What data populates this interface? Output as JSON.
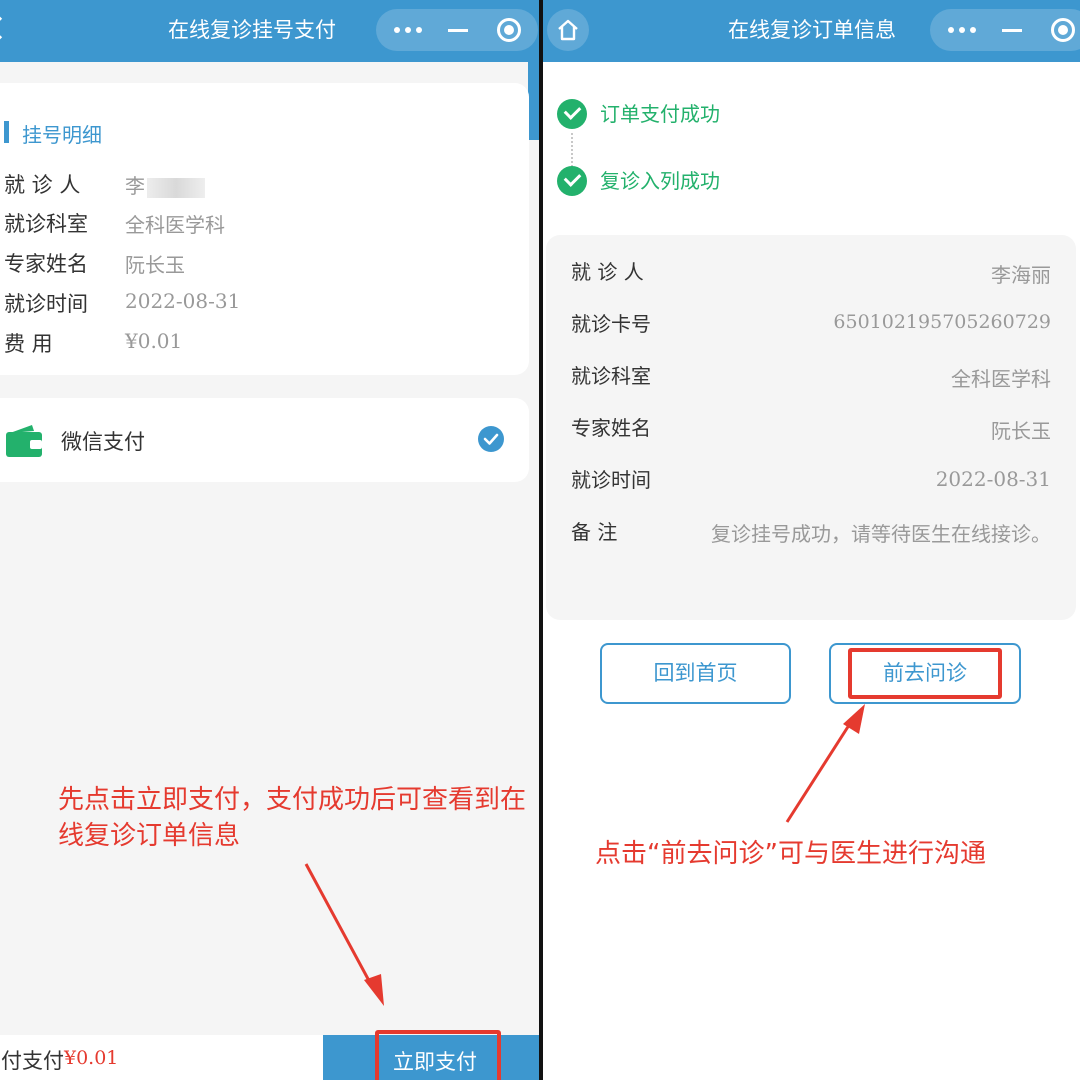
{
  "left": {
    "title": "在线复诊挂号支付",
    "section_title": "挂号明细",
    "rows": [
      {
        "label": "就 诊 人",
        "value": "李"
      },
      {
        "label": "就诊科室",
        "value": "全科医学科"
      },
      {
        "label": "专家姓名",
        "value": "阮长玉"
      },
      {
        "label": "就诊时间",
        "value": "2022-08-31"
      },
      {
        "label": "费 用",
        "value": "¥0.01"
      }
    ],
    "payment_method": "微信支付",
    "footer_label": "实付支付",
    "footer_amount": "¥0.01",
    "pay_button": "立即支付",
    "annotation": "先点击立即支付，支付成功后可查看到在线复诊订单信息"
  },
  "right": {
    "title": "在线复诊订单信息",
    "steps": [
      "订单支付成功",
      "复诊入列成功"
    ],
    "rows": [
      {
        "label": "就 诊 人",
        "value": "李海丽"
      },
      {
        "label": "就诊卡号",
        "value": "650102195705260729"
      },
      {
        "label": "就诊科室",
        "value": "全科医学科"
      },
      {
        "label": "专家姓名",
        "value": "阮长玉"
      },
      {
        "label": "就诊时间",
        "value": "2022-08-31"
      },
      {
        "label": "备 注",
        "value": "复诊挂号成功，请等待医生在线接诊。"
      }
    ],
    "home_button": "回到首页",
    "consult_button": "前去问诊",
    "annotation": "点击“前去问诊”可与医生进行沟通"
  },
  "colors": {
    "brand": "#3d97cf",
    "success": "#23b16c",
    "highlight": "#e53a2f"
  },
  "icons": [
    "chevron-left-icon",
    "more-dots-icon",
    "minimize-icon",
    "close-target-icon",
    "home-icon",
    "wallet-icon",
    "check-circle-icon"
  ]
}
